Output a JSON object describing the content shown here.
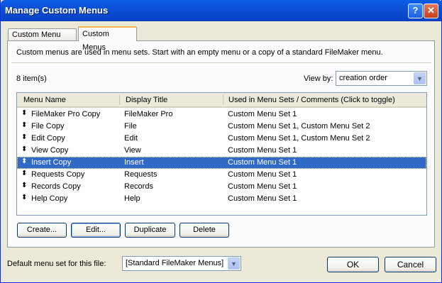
{
  "window": {
    "title": "Manage Custom Menus",
    "help_glyph": "?",
    "close_glyph": "✕"
  },
  "tabs": [
    {
      "label": "Custom Menu Sets",
      "active": false
    },
    {
      "label": "Custom Menus",
      "active": true
    }
  ],
  "description": "Custom menus are used in menu sets. Start with an empty menu or a copy of a standard FileMaker menu.",
  "item_count": "8 item(s)",
  "view_by": {
    "label": "View by:",
    "value": "creation order"
  },
  "list": {
    "columns": [
      "Menu Name",
      "Display Title",
      "Used in Menu Sets / Comments (Click to toggle)"
    ],
    "rows": [
      {
        "name": "FileMaker Pro Copy",
        "title": "FileMaker Pro",
        "used": "Custom Menu Set 1",
        "selected": false
      },
      {
        "name": "File Copy",
        "title": "File",
        "used": "Custom Menu Set 1, Custom Menu Set 2",
        "selected": false
      },
      {
        "name": "Edit Copy",
        "title": "Edit",
        "used": "Custom Menu Set 1, Custom Menu Set 2",
        "selected": false
      },
      {
        "name": "View Copy",
        "title": "View",
        "used": "Custom Menu Set 1",
        "selected": false
      },
      {
        "name": "Insert Copy",
        "title": "Insert",
        "used": "Custom Menu Set 1",
        "selected": true
      },
      {
        "name": "Requests Copy",
        "title": "Requests",
        "used": "Custom Menu Set 1",
        "selected": false
      },
      {
        "name": "Records Copy",
        "title": "Records",
        "used": "Custom Menu Set 1",
        "selected": false
      },
      {
        "name": "Help Copy",
        "title": "Help",
        "used": "Custom Menu Set 1",
        "selected": false
      }
    ],
    "handle_glyph": "⬍"
  },
  "buttons": {
    "create": "Create...",
    "edit": "Edit...",
    "duplicate": "Duplicate",
    "delete": "Delete",
    "ok": "OK",
    "cancel": "Cancel"
  },
  "default_menu_set": {
    "label": "Default menu set for this file:",
    "value": "[Standard FileMaker Menus]"
  },
  "icons": {
    "dropdown": "chevron-down-icon",
    "drag_handle": "drag-handle-icon"
  },
  "colors": {
    "titlebar": "#0842c4",
    "selection": "#316ac5",
    "dialog_bg": "#ece9d8",
    "tab_accent": "#f6b74b"
  }
}
